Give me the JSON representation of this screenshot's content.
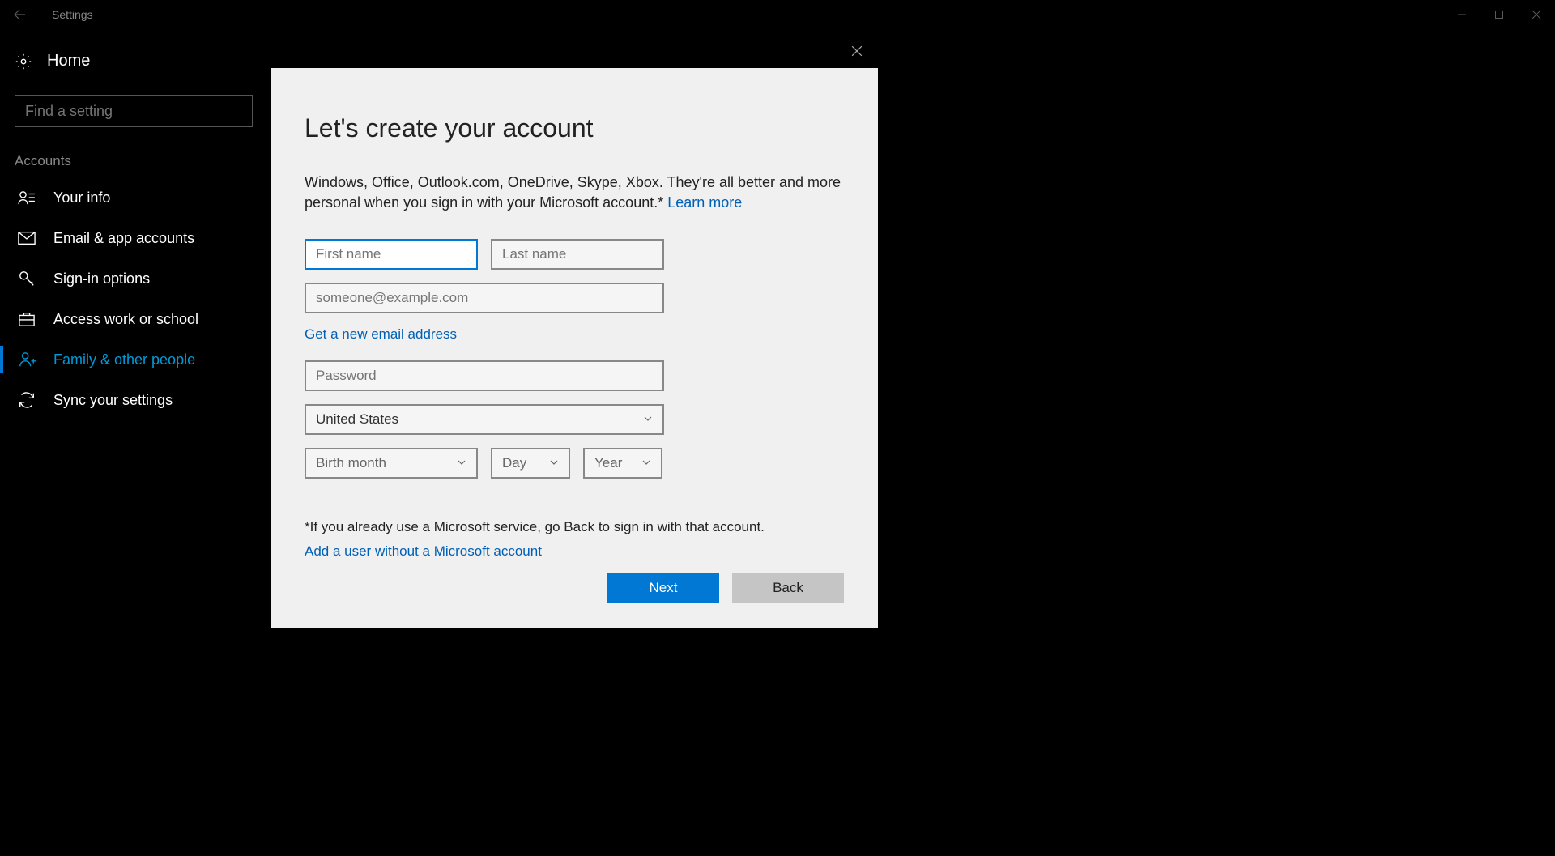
{
  "window": {
    "title": "Settings"
  },
  "sidebar": {
    "home_label": "Home",
    "search_placeholder": "Find a setting",
    "category": "Accounts",
    "items": [
      {
        "label": "Your info"
      },
      {
        "label": "Email & app accounts"
      },
      {
        "label": "Sign-in options"
      },
      {
        "label": "Access work or school"
      },
      {
        "label": "Family & other people"
      },
      {
        "label": "Sync your settings"
      }
    ]
  },
  "dialog": {
    "heading": "Let's create your account",
    "description": "Windows, Office, Outlook.com, OneDrive, Skype, Xbox. They're all better and more personal when you sign in with your Microsoft account.* ",
    "learn_more": "Learn more",
    "first_name_placeholder": "First name",
    "last_name_placeholder": "Last name",
    "email_placeholder": "someone@example.com",
    "get_new_email": "Get a new email address",
    "password_placeholder": "Password",
    "country_value": "United States",
    "birth_month_placeholder": "Birth month",
    "day_placeholder": "Day",
    "year_placeholder": "Year",
    "footer_note": "*If you already use a Microsoft service, go Back to sign in with that account.",
    "add_user_link": "Add a user without a Microsoft account",
    "next_label": "Next",
    "back_label": "Back"
  }
}
